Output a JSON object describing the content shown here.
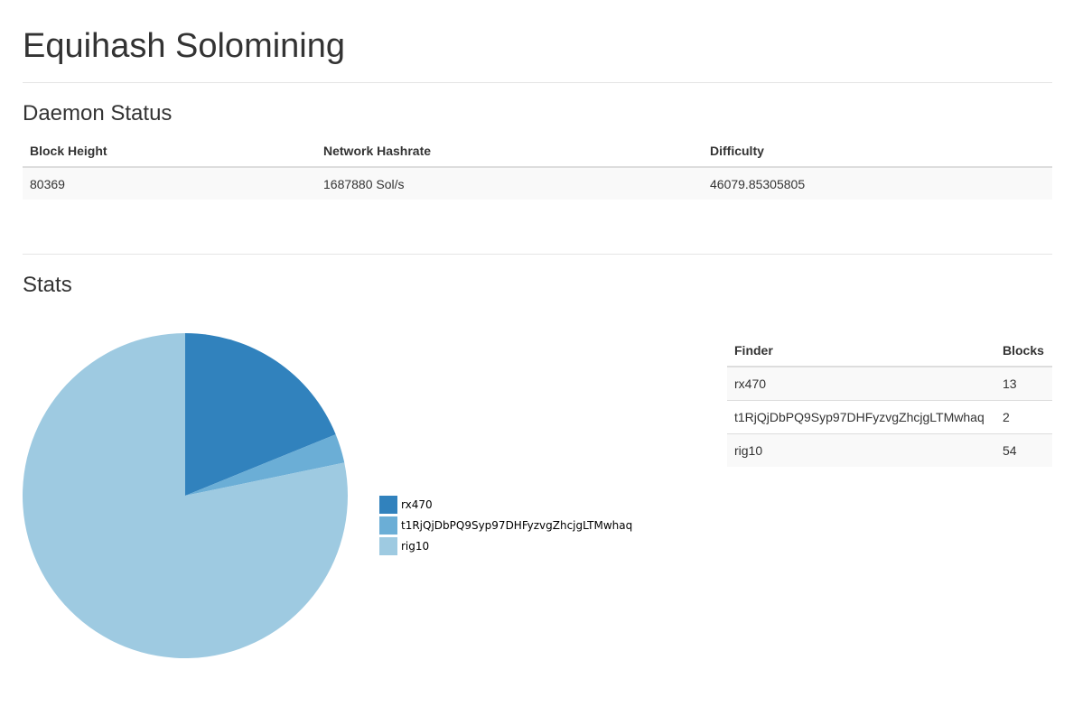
{
  "page": {
    "title": "Equihash Solomining"
  },
  "daemon_status": {
    "title": "Daemon Status",
    "headers": {
      "block_height": "Block Height",
      "network_hashrate": "Network Hashrate",
      "difficulty": "Difficulty"
    },
    "values": {
      "block_height": "80369",
      "network_hashrate": "1687880 Sol/s",
      "difficulty": "46079.85305805"
    }
  },
  "stats": {
    "title": "Stats",
    "table": {
      "headers": {
        "finder": "Finder",
        "blocks": "Blocks"
      },
      "rows": [
        {
          "finder": "rx470",
          "blocks": "13"
        },
        {
          "finder": "t1RjQjDbPQ9Syp97DHFyzvgZhcjgLTMwhaq",
          "blocks": "2"
        },
        {
          "finder": "rig10",
          "blocks": "54"
        }
      ]
    }
  },
  "chart_data": {
    "type": "pie",
    "title": "",
    "labels": [
      "rx470",
      "t1RjQjDbPQ9Syp97DHFyzvgZhcjgLTMwhaq",
      "rig10"
    ],
    "values": [
      13,
      2,
      54
    ],
    "colors": [
      "#3182bd",
      "#6baed6",
      "#9ecae1"
    ],
    "legend_position": "right"
  }
}
